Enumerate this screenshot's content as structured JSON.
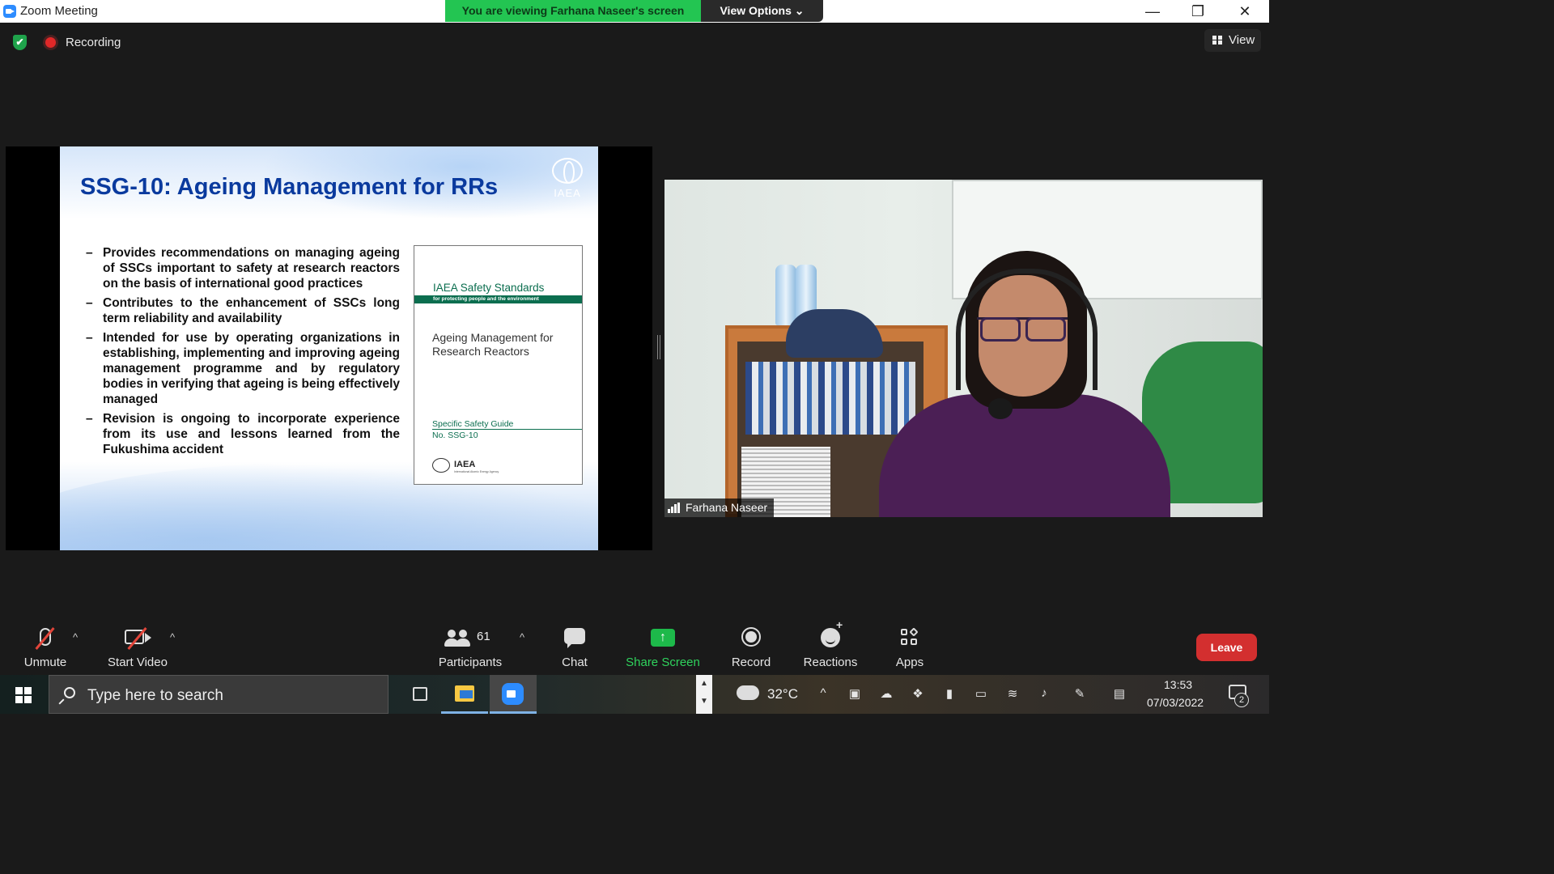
{
  "window": {
    "title": "Zoom Meeting",
    "viewing_banner": "You are viewing Farhana Naseer's screen",
    "view_options_label": "View Options ⌄",
    "minimize": "—",
    "restore": "❐",
    "close": "✕"
  },
  "meeting_bar": {
    "shield_glyph": "✔",
    "recording_label": "Recording",
    "view_label": "View"
  },
  "slide": {
    "title": "SSG-10: Ageing Management for RRs",
    "logo_text": "IAEA",
    "bullets": [
      "Provides recommendations on managing ageing of SSCs important to safety at research reactors on the basis of international good practices",
      "Contributes to the enhancement of SSCs long term reliability and availability",
      "Intended for use by operating organizations in establishing, implementing and improving ageing management programme and by regulatory bodies in verifying that ageing is being effectively managed",
      "Revision is ongoing to incorporate experience from its use and lessons learned from the Fukushima accident"
    ],
    "dash": "–",
    "book": {
      "series": "IAEA Safety Standards",
      "series_sub": "for protecting people and the environment",
      "title": "Ageing Management for Research Reactors",
      "guide_line1": "Specific Safety Guide",
      "guide_line2": "No. SSG-10",
      "footer_logo": "IAEA",
      "footer_sub": "International Atomic Energy Agency"
    }
  },
  "video": {
    "participant_name": "Farhana Naseer"
  },
  "toolbar": {
    "unmute": "Unmute",
    "start_video": "Start Video",
    "participants": "Participants",
    "participants_count": "61",
    "chat": "Chat",
    "share_screen": "Share Screen",
    "share_glyph": "↑",
    "record": "Record",
    "reactions": "Reactions",
    "apps": "Apps",
    "leave": "Leave",
    "caret": "^"
  },
  "taskbar": {
    "search_placeholder": "Type here to search",
    "scroll_up": "▲",
    "scroll_down": "▼",
    "temperature": "32°C",
    "tray_chevron": "^",
    "time": "13:53",
    "date": "07/03/2022",
    "notification_count": "2"
  },
  "colors": {
    "banner_green": "#23c552",
    "leave_red": "#d32f2f",
    "share_green": "#1db94a",
    "slide_title_blue": "#0a3a9e",
    "book_green": "#0b6e4f",
    "zoom_blue": "#2d8cff"
  },
  "icons": [
    "zoom-app-icon",
    "shield-icon",
    "recording-dot-icon",
    "grid-view-icon",
    "microphone-muted-icon",
    "video-off-icon",
    "participants-icon",
    "chat-icon",
    "share-screen-icon",
    "record-icon",
    "reactions-icon",
    "apps-icon",
    "windows-start-icon",
    "search-icon",
    "task-view-icon",
    "file-explorer-icon",
    "weather-icon",
    "notifications-icon"
  ]
}
